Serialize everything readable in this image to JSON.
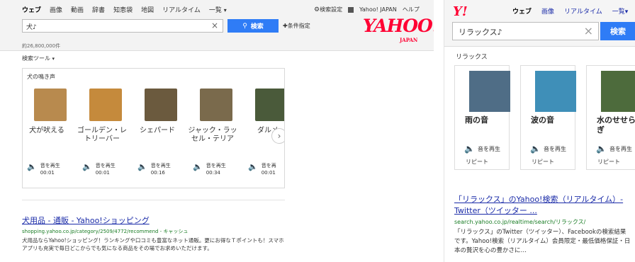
{
  "desktop": {
    "nav": {
      "web": "ウェブ",
      "images": "画像",
      "videos": "動画",
      "dictionary": "辞書",
      "chiebukuro": "知恵袋",
      "maps": "地図",
      "realtime": "リアルタイム",
      "more": "一覧"
    },
    "right_nav": {
      "settings": "検索設定",
      "yahoo_japan": "Yahoo! JAPAN",
      "help": "ヘルプ"
    },
    "search": {
      "value": "犬♪",
      "button": "検索",
      "conditions": "条件指定"
    },
    "logo": {
      "main": "YAHOO!",
      "sub": "JAPAN"
    },
    "result_count": "約26,800,000件",
    "tools": "検索ツール",
    "sound_panel": {
      "title": "犬の鳴き声",
      "items": [
        {
          "name": "犬が吠える",
          "action": "音を再生",
          "duration": "00:01",
          "color": "#b88a4e"
        },
        {
          "name": "ゴールデン・レトリーバー",
          "action": "音を再生",
          "duration": "00:01",
          "color": "#c58a3c"
        },
        {
          "name": "シェパード",
          "action": "音を再生",
          "duration": "00:16",
          "color": "#6b5a3e"
        },
        {
          "name": "ジャック・ラッセル・テリア",
          "action": "音を再生",
          "duration": "00:34",
          "color": "#7a6a4c"
        },
        {
          "name": "ダルメ",
          "action": "音を再",
          "duration": "00:01",
          "color": "#4a5a3a"
        }
      ]
    },
    "result": {
      "title": "犬用品 - 通販 - Yahoo!ショッピング",
      "url": "shopping.yahoo.co.jp/category/2509/4772/recommend - キャッシュ",
      "snippet": "犬用品ならYahoo!ショッピング！ランキングや口コミも豊富なネット通販。更にお得なＴポイントも！スマホアプリも充実で毎日どこからでも気になる商品をその場でお求めいただけます。"
    }
  },
  "mobile": {
    "logo": "Y!",
    "nav": {
      "web": "ウェブ",
      "images": "画像",
      "realtime": "リアルタイム",
      "more": "一覧"
    },
    "search": {
      "value": "リラックス♪",
      "button": "検索"
    },
    "section_title": "リラックス",
    "items": [
      {
        "name": "雨の音",
        "action": "音を再生",
        "repeat": "リピート",
        "color": "#4f6d86"
      },
      {
        "name": "波の音",
        "action": "音を再生",
        "repeat": "リピート",
        "color": "#3f8fb8"
      },
      {
        "name": "水のせせらぎ",
        "action": "音を再生",
        "repeat": "リピート",
        "color": "#4d6b3c"
      }
    ],
    "result": {
      "title": "「リラックス」のYahoo!検索（リアルタイム）- Twitter（ツイッター ...",
      "url": "search.yahoo.co.jp/realtime/search/リラックス/",
      "snippet": "「リラックス」のTwitter（ツイッター）、Facebookの検索結果です。Yahoo!検索（リアルタイム）会員限定・最低価格保証・日本の贅沢を心の豊かさに…"
    }
  }
}
